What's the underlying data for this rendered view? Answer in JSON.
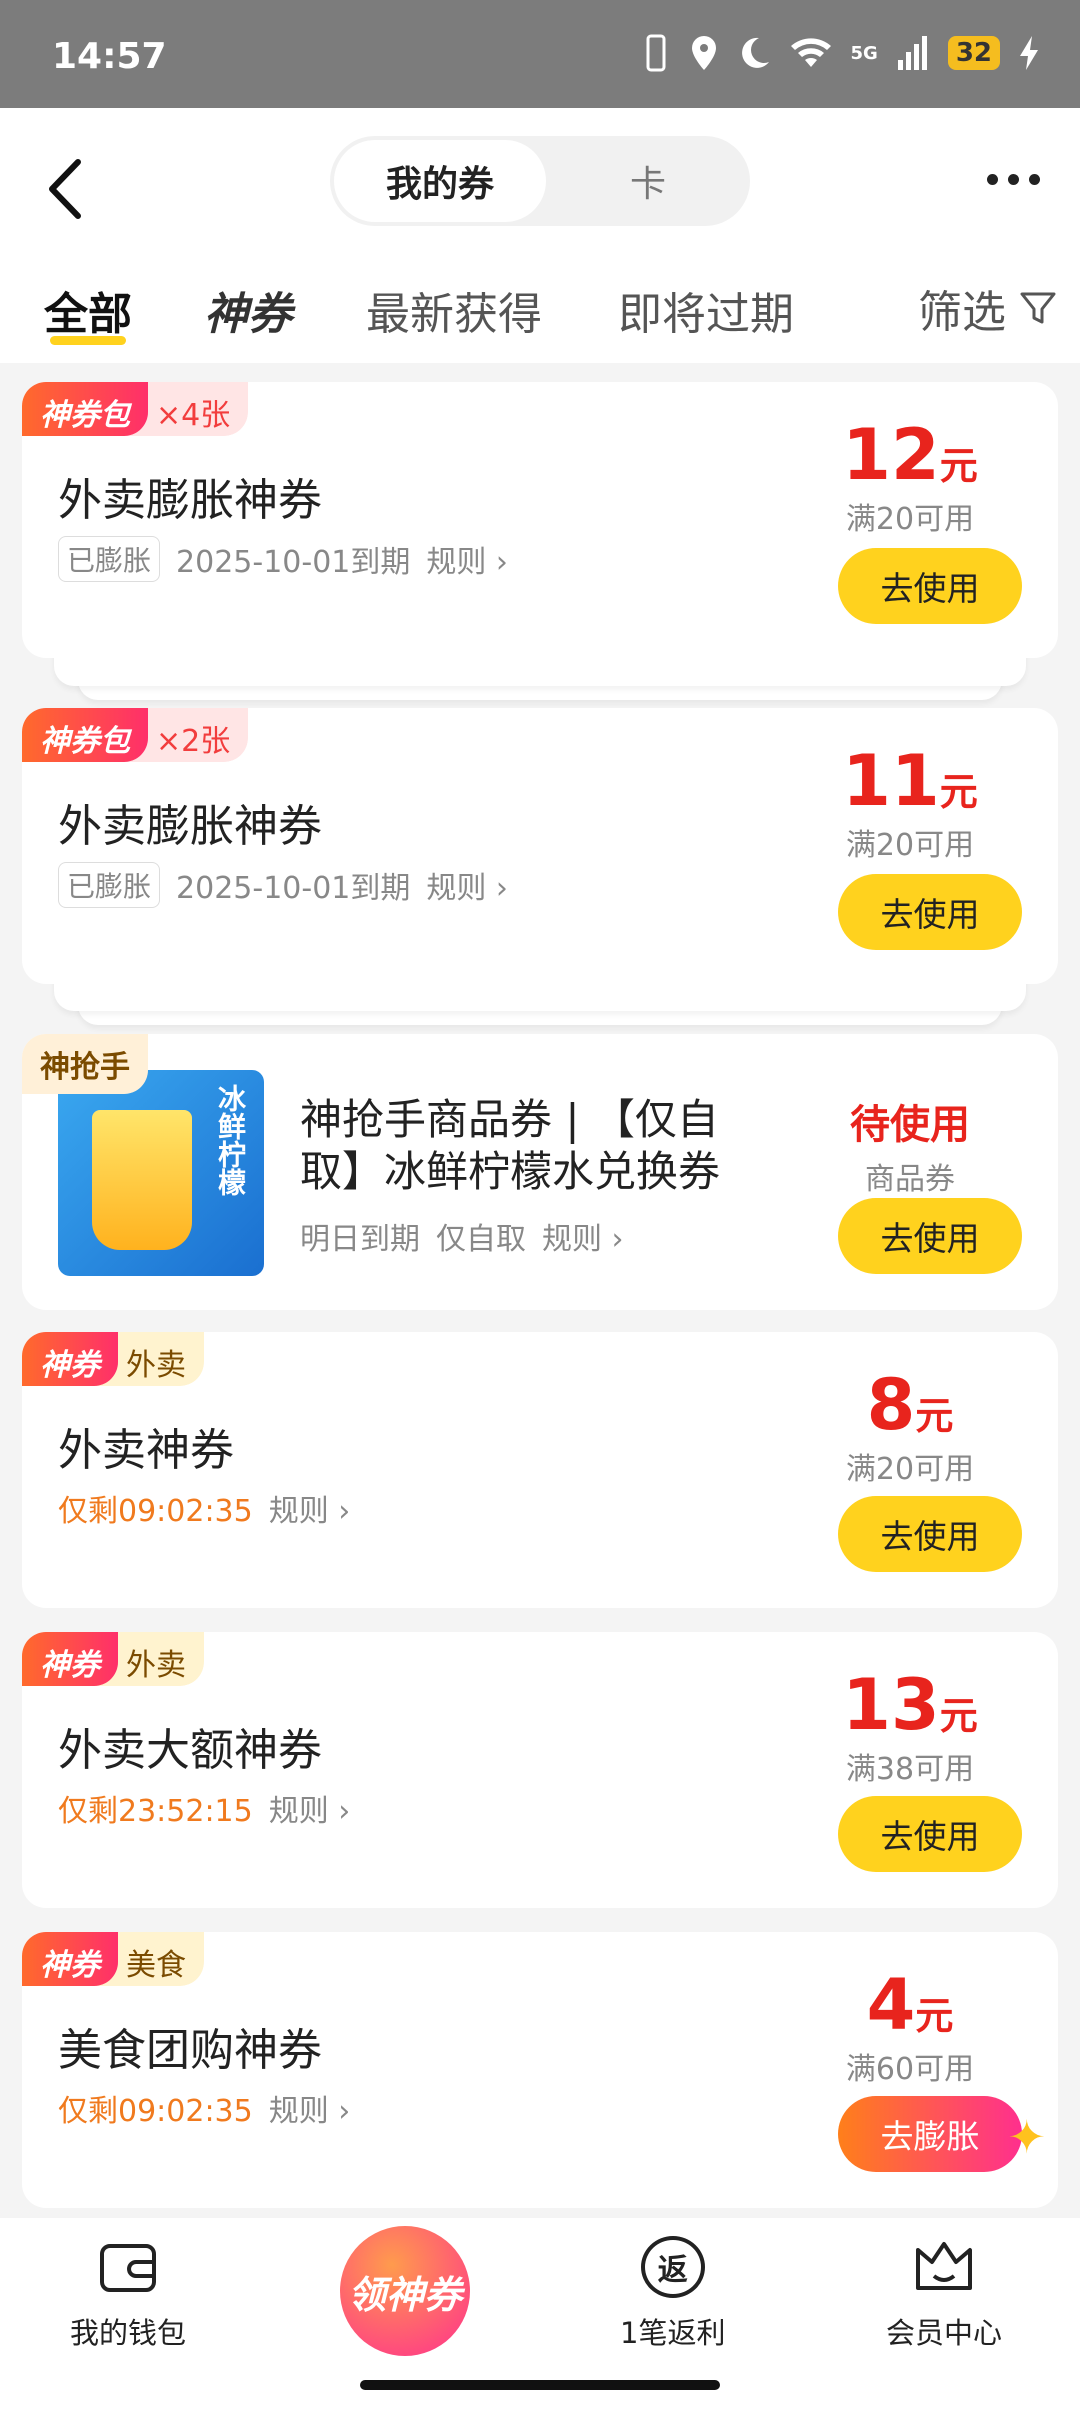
{
  "status": {
    "time": "14:57",
    "signal": "5G",
    "battery": "32"
  },
  "header": {
    "seg_active": "我的券",
    "seg_other": "卡"
  },
  "tabs": {
    "all": "全部",
    "shen": "神券",
    "newest": "最新获得",
    "expiring": "即将过期",
    "filter": "筛选"
  },
  "cards": [
    {
      "tag1": "神券包",
      "tag2": "×4张",
      "title": "外卖膨胀神券",
      "pill": "已膨胀",
      "date": "2025-10-01到期",
      "rule": "规则",
      "amount": "12",
      "unit": "元",
      "cond": "满20可用",
      "btn": "去使用"
    },
    {
      "tag1": "神券包",
      "tag2": "×2张",
      "title": "外卖膨胀神券",
      "pill": "已膨胀",
      "date": "2025-10-01到期",
      "rule": "规则",
      "amount": "11",
      "unit": "元",
      "cond": "满20可用",
      "btn": "去使用"
    },
    {
      "tag1": "神抢手",
      "title_line1": "神抢手商品券 | 【仅自",
      "title_line2": "取】冰鲜柠檬水兑换券",
      "date": "明日到期",
      "scope": "仅自取",
      "rule": "规则",
      "status": "待使用",
      "kind": "商品券",
      "btn": "去使用",
      "img_text": "冰鲜柠檬"
    },
    {
      "tag1": "神券",
      "tag2": "外卖",
      "title": "外卖神券",
      "remain": "仅剩09:02:35",
      "rule": "规则",
      "amount": "8",
      "unit": "元",
      "cond": "满20可用",
      "btn": "去使用"
    },
    {
      "tag1": "神券",
      "tag2": "外卖",
      "title": "外卖大额神券",
      "remain": "仅剩23:52:15",
      "rule": "规则",
      "amount": "13",
      "unit": "元",
      "cond": "满38可用",
      "btn": "去使用"
    },
    {
      "tag1": "神券",
      "tag2": "美食",
      "title": "美食团购神券",
      "remain": "仅剩09:02:35",
      "rule": "规则",
      "amount": "4",
      "unit": "元",
      "cond": "满60可用",
      "btn": "去膨胀"
    }
  ],
  "bottom": {
    "wallet": "我的钱包",
    "center": "领神券",
    "rebate": "1笔返利",
    "rebate_icon": "返",
    "member": "会员中心"
  }
}
